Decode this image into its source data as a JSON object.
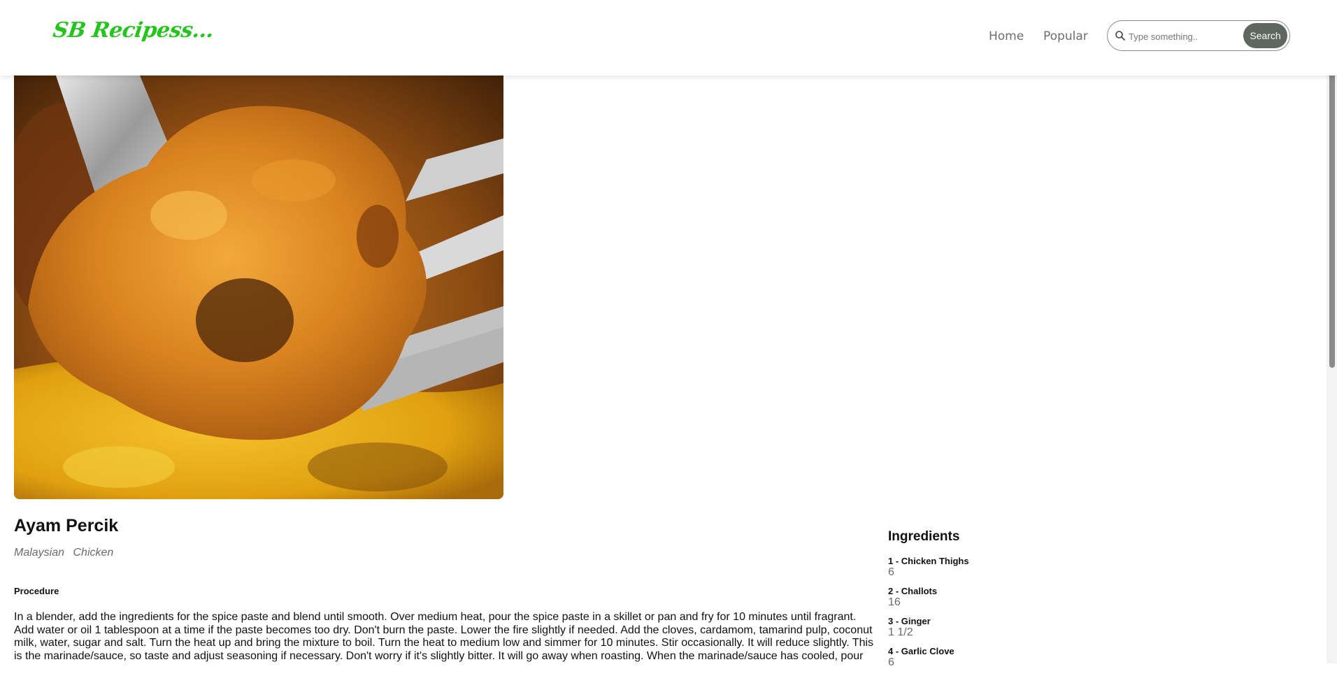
{
  "brand": {
    "logo_text": "SB Recipess...",
    "accent": "#26c41f"
  },
  "nav": {
    "home": "Home",
    "popular": "Popular"
  },
  "search": {
    "placeholder": "Type something..",
    "button_label": "Search",
    "icon": "search-icon"
  },
  "recipe": {
    "title": "Ayam Percik",
    "tags": [
      "Malaysian",
      "Chicken"
    ],
    "procedure_heading": "Procedure",
    "procedure_text": "In a blender, add the ingredients for the spice paste and blend until smooth. Over medium heat, pour the spice paste in a skillet or pan and fry for 10 minutes until fragrant. Add water or oil 1 tablespoon at a time if the paste becomes too dry. Don't burn the paste. Lower the fire slightly if needed. Add the cloves, cardamom, tamarind pulp, coconut milk, water, sugar and salt. Turn the heat up and bring the mixture to boil. Turn the heat to medium low and simmer for 10 minutes. Stir occasionally. It will reduce slightly. This is the marinade/sauce, so taste and adjust seasoning if necessary. Don't worry if it's slightly bitter. It will go away when roasting. When the marinade/sauce has cooled, pour"
  },
  "ingredients": {
    "heading": "Ingredients",
    "items": [
      {
        "label": "1 - Chicken Thighs",
        "qty": "6"
      },
      {
        "label": "2 - Challots",
        "qty": "16"
      },
      {
        "label": "3 - Ginger",
        "qty": "1 1/2"
      },
      {
        "label": "4 - Garlic Clove",
        "qty": "6"
      }
    ]
  }
}
